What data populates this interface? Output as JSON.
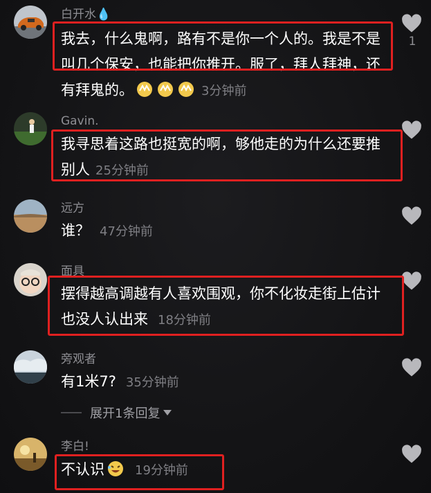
{
  "comments": [
    {
      "username": "白开水💧",
      "text": "我去，什么鬼啊，路有不是你一个人的。我是不是叫几个保安，也能把你推开。服了，拜人拜神，还有拜鬼的。",
      "time": "3分钟前",
      "likes": "1",
      "avatar": "car-avatar"
    },
    {
      "username": "Gavin.",
      "text": "我寻思着这路也挺宽的啊，够他走的为什么还要推别人",
      "time": "25分钟前",
      "avatar": "field-avatar"
    },
    {
      "username": "远方",
      "text": "谁？",
      "time": "47分钟前",
      "avatar": "desert-avatar"
    },
    {
      "username": "面具",
      "text": "摆得越高调越有人喜欢围观，你不化妆走街上估计也没人认出来",
      "time": "18分钟前",
      "avatar": "glasses-face-avatar"
    },
    {
      "username": "旁观者",
      "text": "有1米7?",
      "time": "35分钟前",
      "avatar": "sky-avatar"
    },
    {
      "username": "李白!",
      "text": "不认识",
      "time": "19分钟前",
      "avatar": "sunset-avatar"
    }
  ],
  "reply_toggle": "展开1条回复",
  "colors": {
    "highlight": "#e02020",
    "background": "#131315",
    "muted_text": "#8e8e93"
  }
}
